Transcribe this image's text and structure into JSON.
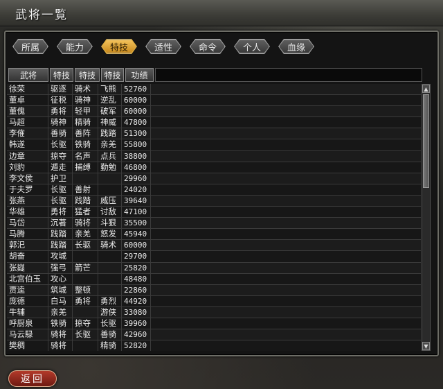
{
  "window": {
    "title": "武将一覧"
  },
  "tabs": [
    {
      "label": "所属",
      "active": false
    },
    {
      "label": "能力",
      "active": false
    },
    {
      "label": "特技",
      "active": true
    },
    {
      "label": "适性",
      "active": false
    },
    {
      "label": "命令",
      "active": false
    },
    {
      "label": "个人",
      "active": false
    },
    {
      "label": "血缘",
      "active": false
    }
  ],
  "columns": [
    "武将",
    "特技",
    "特技",
    "特技",
    "功绩"
  ],
  "rows": [
    [
      "徐荣",
      "驱逐",
      "骑术",
      "飞熊",
      "52760"
    ],
    [
      "董卓",
      "征税",
      "骑神",
      "逆乱",
      "60000"
    ],
    [
      "董傀",
      "勇将",
      "轻甲",
      "破军",
      "60000"
    ],
    [
      "马超",
      "骑神",
      "精骑",
      "神威",
      "47800"
    ],
    [
      "李傕",
      "善骑",
      "善阵",
      "践踏",
      "51300"
    ],
    [
      "韩遂",
      "长驱",
      "铁骑",
      "亲羌",
      "55800"
    ],
    [
      "边章",
      "掠夺",
      "名声",
      "点兵",
      "38800"
    ],
    [
      "刘豹",
      "遁走",
      "捕缚",
      "勤勉",
      "46800"
    ],
    [
      "李文侯",
      "护卫",
      "",
      "",
      "29960"
    ],
    [
      "于夫罗",
      "长驱",
      "善射",
      "",
      "24020"
    ],
    [
      "张燕",
      "长驱",
      "践踏",
      "威压",
      "39640"
    ],
    [
      "华雄",
      "勇将",
      "猛者",
      "讨敌",
      "47100"
    ],
    [
      "马岱",
      "沉著",
      "骑将",
      "斗狠",
      "35500"
    ],
    [
      "马腾",
      "践踏",
      "亲羌",
      "怒发",
      "45940"
    ],
    [
      "郭汜",
      "践踏",
      "长驱",
      "骑术",
      "60000"
    ],
    [
      "胡奋",
      "攻城",
      "",
      "",
      "29700"
    ],
    [
      "张嶷",
      "强弓",
      "箭芒",
      "",
      "25820"
    ],
    [
      "北宫伯玉",
      "攻心",
      "",
      "",
      "48480"
    ],
    [
      "贾逵",
      "筑城",
      "整顿",
      "",
      "22860"
    ],
    [
      "庞德",
      "白马",
      "勇将",
      "勇烈",
      "44920"
    ],
    [
      "牛辅",
      "亲羌",
      "",
      "游侠",
      "33080"
    ],
    [
      "呼厨泉",
      "铁骑",
      "掠夺",
      "长驱",
      "39960"
    ],
    [
      "马云騄",
      "骑将",
      "长驱",
      "善骑",
      "42960"
    ],
    [
      "樊稠",
      "骑将",
      "",
      "精骑",
      "52820"
    ]
  ],
  "buttons": {
    "back": "返回"
  },
  "icons": {
    "scroll_up": "triangle-up-icon",
    "scroll_down": "triangle-down-icon"
  },
  "colors": {
    "active_tab": "#e0b040",
    "back_button": "#a8321f"
  }
}
